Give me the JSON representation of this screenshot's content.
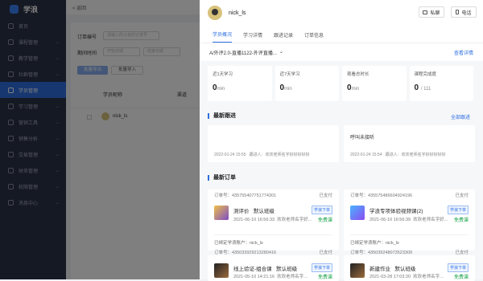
{
  "app": {
    "name": "学浪"
  },
  "sidebar": {
    "items": [
      {
        "label": "首页"
      },
      {
        "label": "课程管理"
      },
      {
        "label": "教学管理"
      },
      {
        "label": "社群管理"
      },
      {
        "label": "学员管理"
      },
      {
        "label": "学习管理"
      },
      {
        "label": "营销工具"
      },
      {
        "label": "销售分析"
      },
      {
        "label": "交易管理"
      },
      {
        "label": "财务管理"
      },
      {
        "label": "权限管理"
      },
      {
        "label": "消息中心"
      }
    ]
  },
  "main": {
    "back_label": "< 返回",
    "order_label": "订单编号",
    "order_placeholder": "请输入所以含的订单号",
    "time_label": "期间时间",
    "start_placeholder": "开始日期",
    "end_placeholder": "结束日期",
    "export_label": "批量导出",
    "reset_label": "批量导入",
    "col_name": "学员昵称",
    "col_channel": "渠道",
    "row_name": "nick_ls"
  },
  "panel": {
    "user_name": "nick_ls",
    "msg_button": "私聊",
    "phone_button": "电话",
    "tabs": [
      "学员概况",
      "学习详情",
      "跟进记录",
      "订单信息"
    ],
    "course_select": "A/外评2.0-直播1122-外评直播...",
    "course_link": "查看详情",
    "stats": [
      {
        "label": "近1天学习",
        "value": "0",
        "unit": "min"
      },
      {
        "label": "近7天学习",
        "value": "0",
        "unit": "min"
      },
      {
        "label": "观看总时长",
        "value": "0",
        "unit": "min"
      },
      {
        "label": "课程完成度",
        "value": "0",
        "unit": "/ 111"
      }
    ],
    "followup": {
      "title": "最新跟进",
      "all_link": "全部跟进",
      "items": [
        {
          "content": "",
          "time": "2022-01-24 15:55",
          "author": "跟进人：欢欢老师名字好好好好好"
        },
        {
          "content": "呼叫未接听",
          "time": "2022-01-24 15:54",
          "author": "跟进人：欢欢老师名字好好好好好"
        }
      ]
    },
    "orders": {
      "title": "最新订单",
      "items": [
        {
          "no": "订单号：4357554077517743​01",
          "status": "已支付",
          "course": "测评价",
          "class": "默认班级",
          "time": "2021-06-10 16:56:33",
          "teacher": "欢欢老师名字好...",
          "badge": "学浪下单",
          "price": "免费课",
          "bind": "已绑定学浪账户：nick_ls"
        },
        {
          "no": "订单号：435575486604924196",
          "status": "已支付",
          "course": "学浪专项体验视频课(2)",
          "class": "",
          "time": "2021-06-10 16:56:39",
          "teacher": "欢欢老师名字好...",
          "badge": "学浪下单",
          "price": "免费课",
          "bind": "已绑定学浪账户：nick_ls"
        },
        {
          "no": "订单号：435033929213280416",
          "status": "已支付",
          "course": "线上验证-组合课",
          "class": "默认班级",
          "time": "2021-05-10 14:21:16",
          "teacher": "欢欢老师名字...",
          "badge": "学浪下单",
          "price": "免费课",
          "bind": ""
        },
        {
          "no": "订单号：435039248073523309",
          "status": "已支付",
          "course": "新建作业",
          "class": "默认班级",
          "time": "2021-03-28 17:03:20",
          "teacher": "欢欢老师名字...",
          "badge": "学浪下单",
          "price": "免费课",
          "bind": ""
        }
      ]
    }
  }
}
